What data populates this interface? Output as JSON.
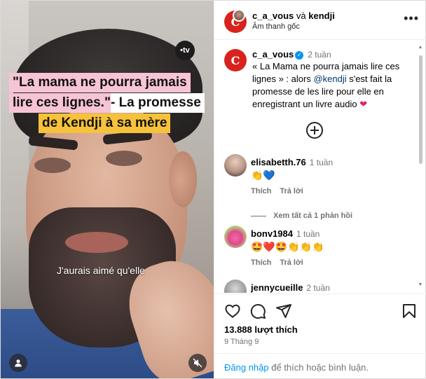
{
  "video": {
    "channel_logo": "•tv",
    "headline": {
      "line1": "\"La mama ne pourra jamais",
      "line2a": "lire ces lignes.\"",
      "line2b": " - La promesse",
      "line3": "de Kendji à sa mère"
    },
    "subtitle": "J'aurais aimé qu'elle",
    "icons": {
      "tag_people": "user-icon",
      "mute": "muted-speaker-icon"
    }
  },
  "header": {
    "author": "c_a_vous",
    "conjunction": "và",
    "collaborator": "kendji",
    "audio_label": "Âm thanh gốc",
    "more_icon": "more-icon"
  },
  "caption": {
    "username": "c_a_vous",
    "time": "2 tuần",
    "text_before_mention": "« La Mama ne pourra jamais lire ces lignes » : alors ",
    "mention": "@kendji",
    "text_after_mention": " s'est fait la promesse de les lire pour elle en enregistrant un livre audio ",
    "emoji": "❤"
  },
  "comments": [
    {
      "username": "elisabetth.76",
      "time": "1 tuần",
      "text": "👏💙",
      "like_label": "Thích",
      "reply_label": "Trả lời"
    },
    {
      "view_replies": "Xem tất cả 1 phản hồi"
    },
    {
      "username": "bonv1984",
      "time": "1 tuần",
      "text": "🤩❤️🤩👏👏👏",
      "like_label": "Thích",
      "reply_label": "Trả lời"
    },
    {
      "username": "jennycueille",
      "time": "2 tuần"
    }
  ],
  "footer": {
    "likes": "13.888 lượt thích",
    "date": "9 Tháng 9",
    "login_link": "Đăng nhập",
    "login_text": " để thích hoặc bình luận.",
    "icons": [
      "heart-icon",
      "comment-icon",
      "share-icon",
      "bookmark-icon"
    ]
  },
  "colors": {
    "brand_red": "#d8231d",
    "link_blue": "#0095f6",
    "verified_blue": "#0095f6",
    "mention": "#00376b"
  }
}
